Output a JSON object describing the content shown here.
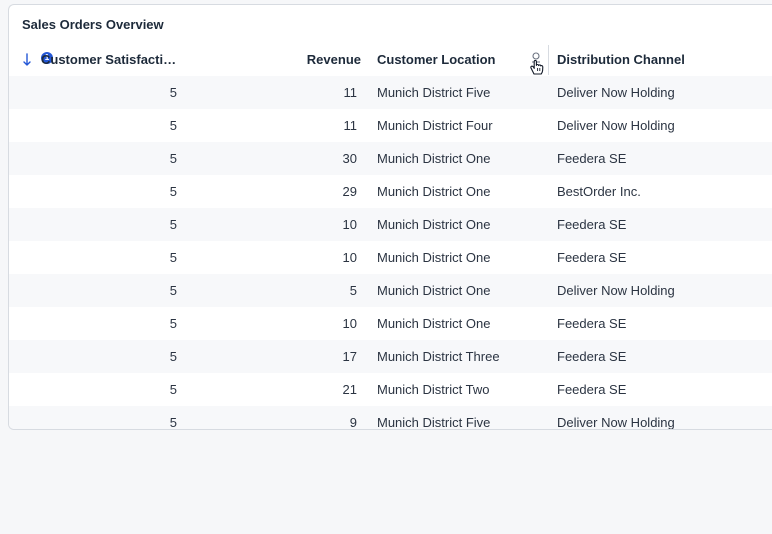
{
  "card": {
    "title": "Sales Orders Overview"
  },
  "sort": {
    "badge": "1"
  },
  "columns": {
    "satisfaction": "Customer Satisfacti…",
    "revenue": "Revenue",
    "location": "Customer Location",
    "channel": "Distribution Channel"
  },
  "rows": [
    {
      "satisfaction": "5",
      "revenue": "11",
      "location": "Munich District Five",
      "channel": "Deliver Now Holding"
    },
    {
      "satisfaction": "5",
      "revenue": "11",
      "location": "Munich District Four",
      "channel": "Deliver Now Holding"
    },
    {
      "satisfaction": "5",
      "revenue": "30",
      "location": "Munich District One",
      "channel": "Feedera SE"
    },
    {
      "satisfaction": "5",
      "revenue": "29",
      "location": "Munich District One",
      "channel": "BestOrder Inc."
    },
    {
      "satisfaction": "5",
      "revenue": "10",
      "location": "Munich District One",
      "channel": "Feedera SE"
    },
    {
      "satisfaction": "5",
      "revenue": "10",
      "location": "Munich District One",
      "channel": "Feedera SE"
    },
    {
      "satisfaction": "5",
      "revenue": "5",
      "location": "Munich District One",
      "channel": "Deliver Now Holding"
    },
    {
      "satisfaction": "5",
      "revenue": "10",
      "location": "Munich District One",
      "channel": "Feedera SE"
    },
    {
      "satisfaction": "5",
      "revenue": "17",
      "location": "Munich District Three",
      "channel": "Feedera SE"
    },
    {
      "satisfaction": "5",
      "revenue": "21",
      "location": "Munich District Two",
      "channel": "Feedera SE"
    },
    {
      "satisfaction": "5",
      "revenue": "9",
      "location": "Munich District Five",
      "channel": "Deliver Now Holding"
    }
  ],
  "colors": {
    "accent": "#2457d6",
    "row_alt": "#f7f8fa",
    "border": "#d7dbe1",
    "page_bg": "#f6f7f9"
  }
}
